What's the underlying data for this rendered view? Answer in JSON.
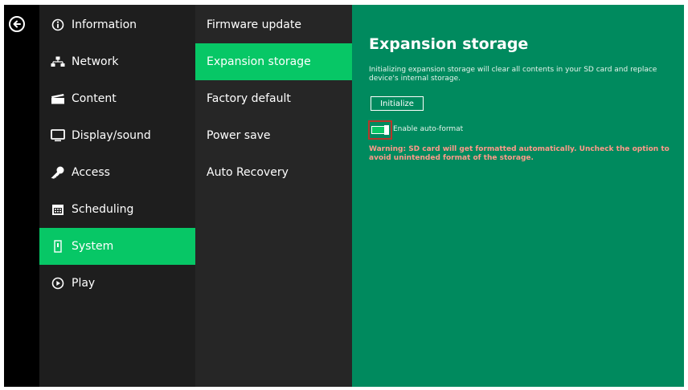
{
  "back_icon": "arrow-left-circle-icon",
  "main_menu": [
    {
      "label": "Information",
      "icon": "info-icon"
    },
    {
      "label": "Network",
      "icon": "network-icon"
    },
    {
      "label": "Content",
      "icon": "clapperboard-icon"
    },
    {
      "label": "Display/sound",
      "icon": "monitor-icon"
    },
    {
      "label": "Access",
      "icon": "key-icon"
    },
    {
      "label": "Scheduling",
      "icon": "calendar-icon"
    },
    {
      "label": "System",
      "icon": "device-icon",
      "active": true
    },
    {
      "label": "Play",
      "icon": "play-circle-icon"
    }
  ],
  "sub_menu": [
    {
      "label": "Firmware update"
    },
    {
      "label": "Expansion storage",
      "active": true
    },
    {
      "label": "Factory default"
    },
    {
      "label": "Power save"
    },
    {
      "label": "Auto Recovery"
    }
  ],
  "panel": {
    "title": "Expansion storage",
    "description": "Initializing expansion storage will clear all contents in your SD card and replace device's internal storage.",
    "initialize_button": "Initialize",
    "auto_format_label": "Enable auto-format",
    "auto_format_enabled": true,
    "warning": "Warning: SD card will get formatted automatically. Uncheck the option to avoid unintended format of the storage."
  },
  "colors": {
    "accent": "#07c766",
    "panel_bg": "#008a5e",
    "warning": "#ff9a8a",
    "highlight_border": "#b8352a"
  }
}
